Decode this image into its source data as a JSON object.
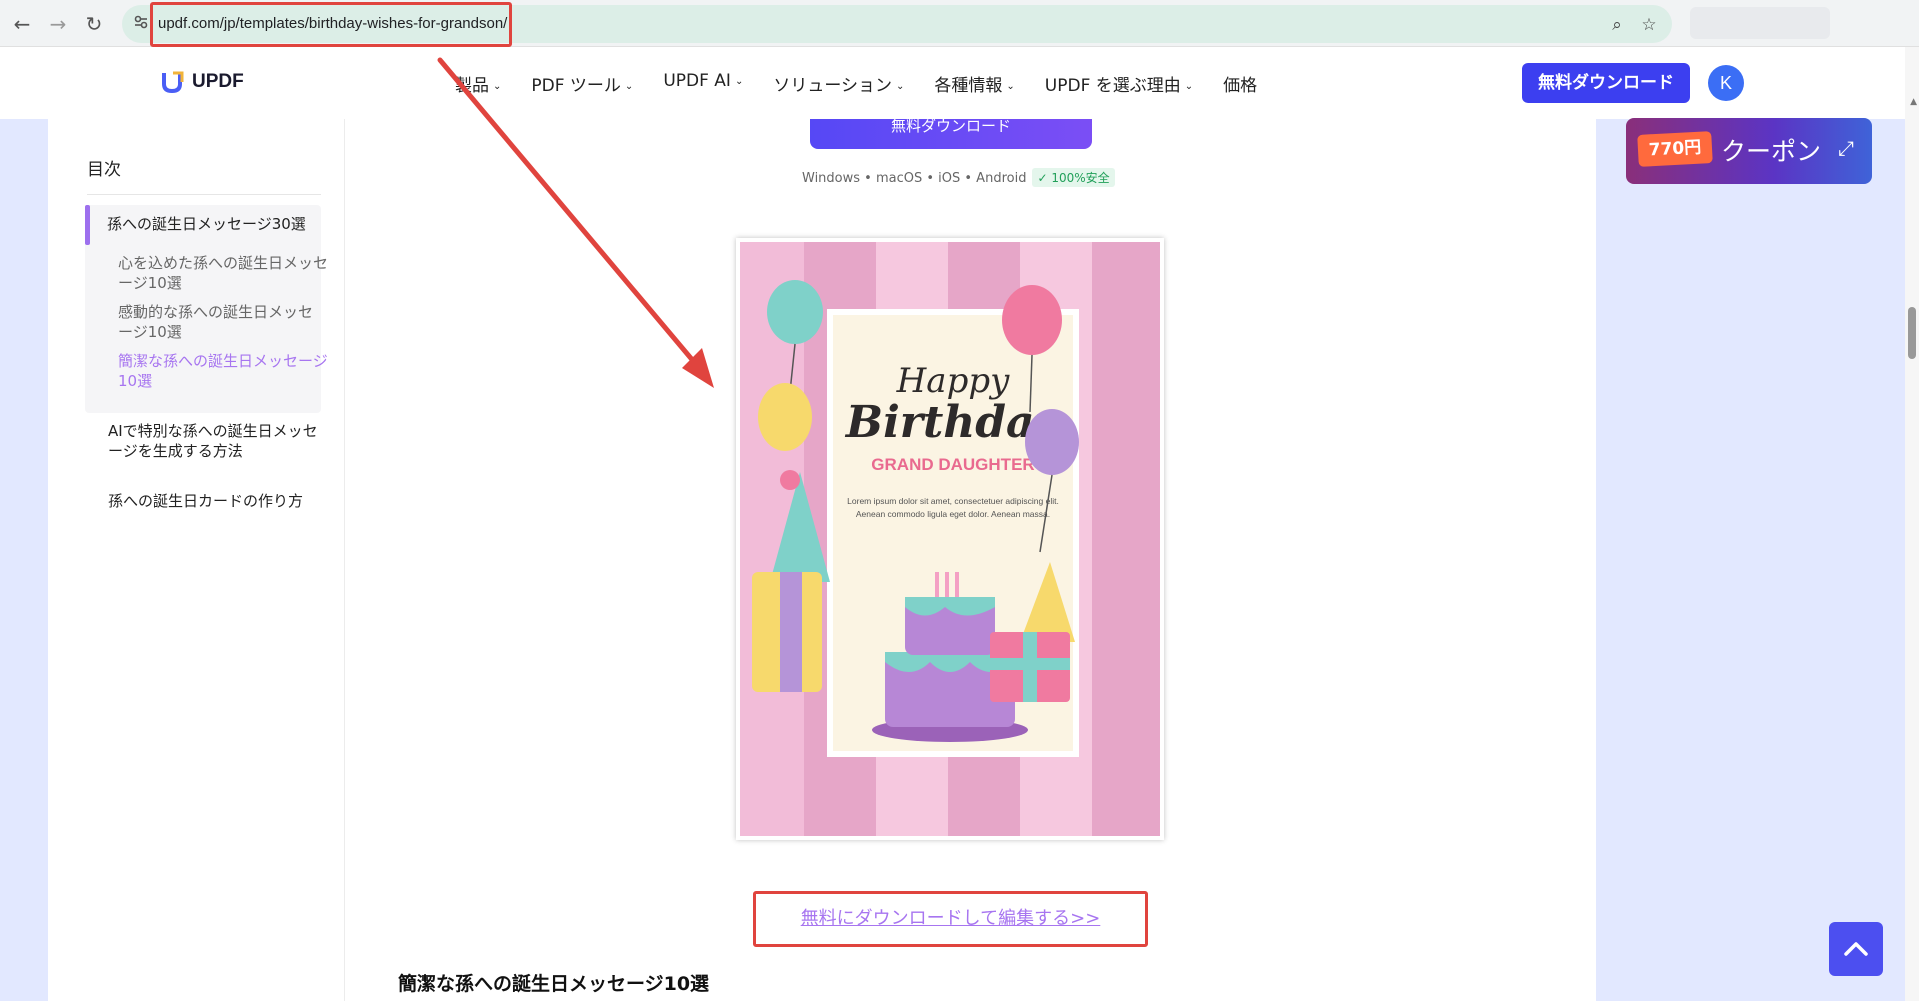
{
  "browser": {
    "url": "updf.com/jp/templates/birthday-wishes-for-grandson/",
    "back_icon": "←",
    "forward_icon": "→",
    "reload_icon": "↻",
    "zoom_icon": "⌕",
    "star_icon": "☆"
  },
  "header": {
    "logo_text": "UPDF",
    "nav": [
      {
        "label": "製品",
        "chevron": "⌄"
      },
      {
        "label": "PDF ツール",
        "chevron": "⌄"
      },
      {
        "label": "UPDF AI",
        "chevron": "⌄"
      },
      {
        "label": "ソリューション",
        "chevron": "⌄"
      },
      {
        "label": "各種情報",
        "chevron": "⌄"
      },
      {
        "label": "UPDF を選ぶ理由",
        "chevron": "⌄"
      },
      {
        "label": "価格",
        "chevron": ""
      }
    ],
    "download_label": "無料ダウンロード",
    "avatar_initial": "K"
  },
  "toc": {
    "title": "目次",
    "items": [
      {
        "label": "孫への誕生日メッセージ30選"
      },
      {
        "label": "心を込めた孫への誕生日メッセージ10選"
      },
      {
        "label": "感動的な孫への誕生日メッセージ10選"
      },
      {
        "label": "簡潔な孫への誕生日メッセージ10選"
      },
      {
        "label": "AIで特別な孫への誕生日メッセージを生成する方法"
      },
      {
        "label": "孫への誕生日カードの作り方"
      }
    ]
  },
  "main": {
    "download_button_label": "無料ダウンロード",
    "platforms": "Windows • macOS • iOS • Android",
    "safe_badge": "100%安全",
    "template": {
      "line1": "Happy",
      "line2": "Birthday",
      "subtitle": "GRAND DAUGHTER",
      "body_line1": "Lorem ipsum dolor sit amet, consectetuer adipiscing elit.",
      "body_line2": "Aenean commodo ligula eget dolor. Aenean massa."
    },
    "edit_link": "無料にダウンロードして編集する>>",
    "section_heading": "簡潔な孫への誕生日メッセージ10選"
  },
  "coupon": {
    "price": "770円",
    "label": "クーポン",
    "expand_icon": "⤢"
  },
  "colors": {
    "accent": "#3c3ff0",
    "toc_active": "#a775f0",
    "annotation": "#e0443e"
  }
}
